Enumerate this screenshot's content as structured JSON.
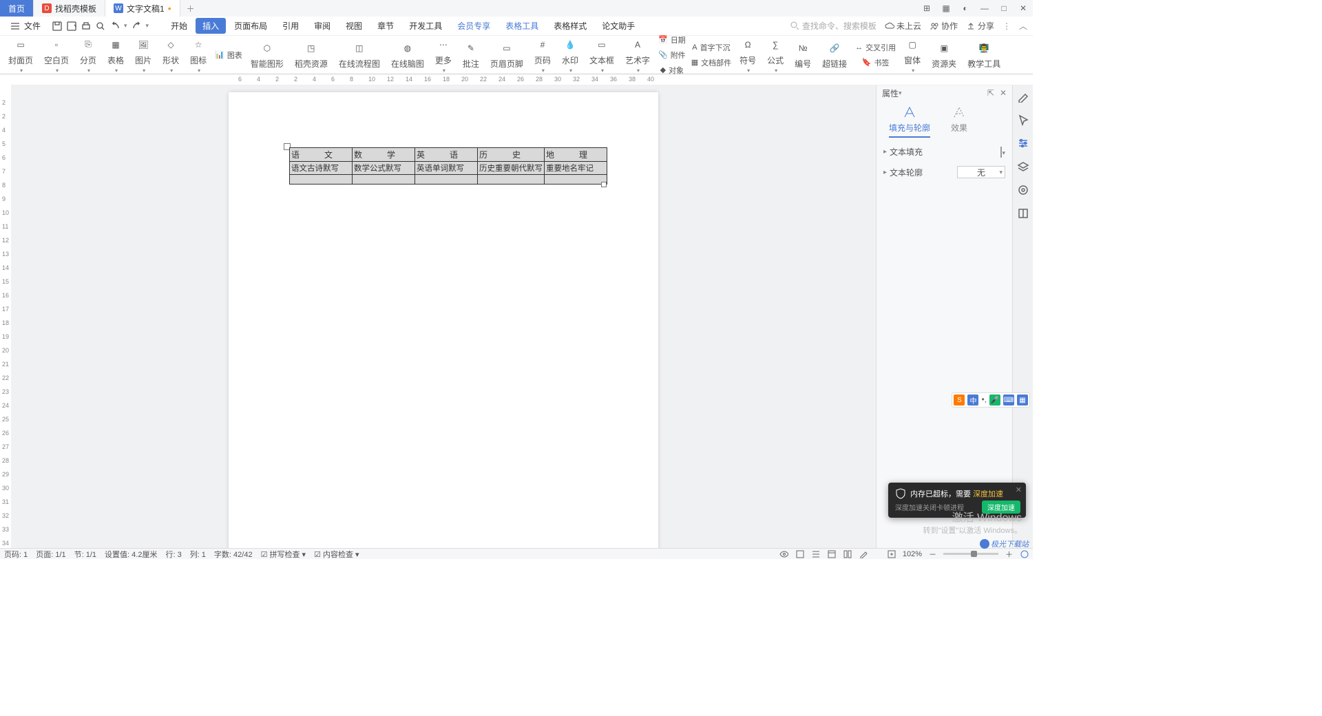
{
  "tabs": {
    "home": "首页",
    "t1": "找稻壳模板",
    "t2": "文字文稿1"
  },
  "winctrl": {
    "layout": "⊞",
    "grid": "▦",
    "theme": "◐",
    "min": "—",
    "max": "□",
    "close": "✕"
  },
  "file_label": "文件",
  "menus": [
    "开始",
    "插入",
    "页面布局",
    "引用",
    "审阅",
    "视图",
    "章节",
    "开发工具",
    "会员专享",
    "表格工具",
    "表格样式",
    "论文助手"
  ],
  "active_menu": 1,
  "blue_menus": [
    8,
    9
  ],
  "search_placeholder": "查找命令、搜索模板",
  "search_prefix": "Q",
  "topright": {
    "cloud": "未上云",
    "coop": "协作",
    "share": "分享"
  },
  "ribbon": [
    {
      "l": "封面页",
      "d": 1
    },
    {
      "l": "空白页",
      "d": 1
    },
    {
      "l": "分页",
      "d": 1
    },
    {
      "l": "表格",
      "d": 1
    },
    {
      "l": "图片",
      "d": 1
    },
    {
      "l": "形状",
      "d": 1
    },
    {
      "l": "图标",
      "d": 1
    },
    {
      "l": "图表",
      "small": 1
    },
    {
      "l": "智能图形",
      "small": 0
    },
    {
      "l": "稻壳资源"
    },
    {
      "l": "在线流程图"
    },
    {
      "l": "在线脑图"
    },
    {
      "l": "更多",
      "d": 1
    },
    {
      "l": "批注"
    },
    {
      "l": "页眉页脚"
    },
    {
      "l": "页码",
      "d": 1
    },
    {
      "l": "水印",
      "d": 1
    },
    {
      "l": "文本框",
      "d": 1
    },
    {
      "l": "艺术字",
      "d": 1
    },
    {
      "l": "日期",
      "small": 1
    },
    {
      "l": "附件",
      "small": 1
    },
    {
      "l": "对象",
      "small": 1
    },
    {
      "l": "首字下沉",
      "small": 1
    },
    {
      "l": "文档部件",
      "small": 1
    },
    {
      "l": "符号",
      "d": 1
    },
    {
      "l": "公式",
      "d": 1
    },
    {
      "l": "编号"
    },
    {
      "l": "超链接"
    },
    {
      "l": "交叉引用",
      "small": 1
    },
    {
      "l": "书签",
      "small": 1
    },
    {
      "l": "窗体",
      "d": 1
    },
    {
      "l": "资源夹"
    },
    {
      "l": "教学工具"
    }
  ],
  "hruler": [
    6,
    4,
    2,
    2,
    4,
    6,
    8,
    10,
    12,
    14,
    16,
    18,
    20,
    22,
    24,
    26,
    28,
    30,
    32,
    34,
    36,
    38,
    40
  ],
  "vruler": [
    2,
    2,
    4,
    5,
    6,
    7,
    8,
    9,
    10,
    11,
    12,
    13,
    14,
    15,
    16,
    17,
    18,
    19,
    20,
    21,
    22,
    23,
    24,
    25,
    26,
    27,
    28,
    29,
    30,
    31,
    32,
    33,
    34
  ],
  "table": {
    "widths": [
      91,
      91,
      91,
      91,
      91
    ],
    "r1": [
      "语　　　文",
      "数　　　学",
      "英　　　语",
      "历　　　史",
      "地　　　理"
    ],
    "r2": [
      "语文古诗默写",
      "数学公式默写",
      "英语单词默写",
      "历史重要朝代默写",
      "重要地名牢记"
    ]
  },
  "panel": {
    "title": "属性",
    "tab1": "填充与轮廓",
    "tab2": "效果",
    "row1": "文本填充",
    "row2": "文本轮廓",
    "outline_val": "无"
  },
  "status": {
    "page_no": "页码: 1",
    "page": "页面: 1/1",
    "sec": "节: 1/1",
    "pos": "设置值: 4.2厘米",
    "row": "行: 3",
    "col": "列: 1",
    "words": "字数: 42/42",
    "spell": "拼写检查",
    "content": "内容检查",
    "zoom": "102%"
  },
  "popup": {
    "line1a": "内存已超标，需要",
    "hl": "深度加速",
    "line2": "深度加速关闭卡顿进程",
    "btn": "深度加速"
  },
  "watermark": {
    "l1": "激活 Windows",
    "l2": "转到\"设置\"以激活 Windows。"
  },
  "logo": "极光下载站"
}
